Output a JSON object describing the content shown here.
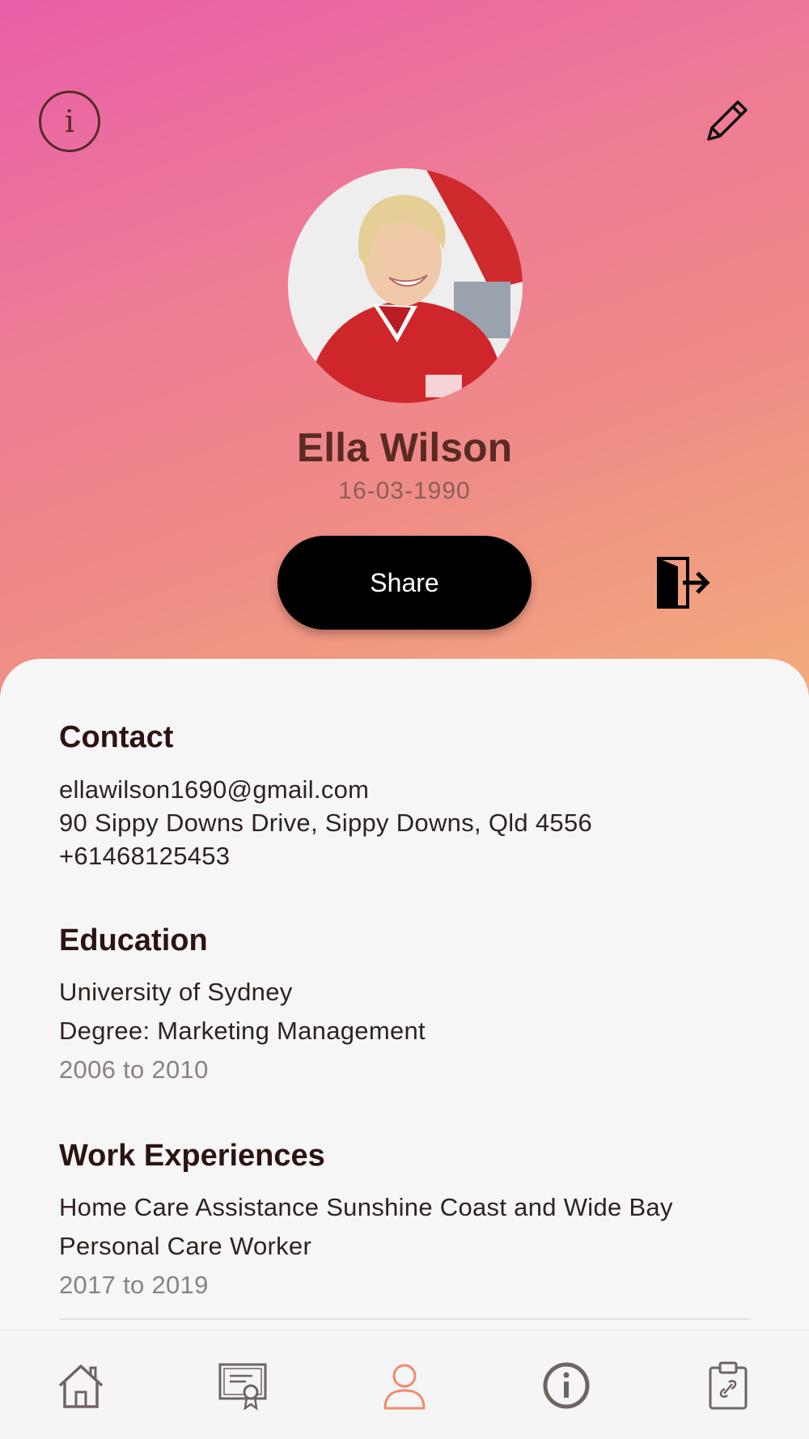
{
  "profile": {
    "name": "Ella Wilson",
    "dob": "16-03-1990",
    "share_label": "Share"
  },
  "icons": {
    "info": "i"
  },
  "contact": {
    "title": "Contact",
    "email": "ellawilson1690@gmail.com",
    "address": "90 Sippy Downs Drive, Sippy Downs, Qld 4556",
    "phone": "+61468125453"
  },
  "education": {
    "title": "Education",
    "school": "University of Sydney",
    "degree": "Degree: Marketing Management",
    "years": "2006 to 2010"
  },
  "work": {
    "title": "Work Experiences",
    "company": "Home Care Assistance Sunshine Coast and Wide Bay",
    "role": "Personal Care Worker",
    "years": "2017 to 2019"
  },
  "tabbar": {
    "items": [
      "home-icon",
      "certificate-icon",
      "profile-icon",
      "info-icon",
      "clipboard-link-icon"
    ],
    "active": "profile-icon",
    "active_color": "#f08a6f",
    "inactive_color": "#6e6462"
  },
  "colors": {
    "gradient_start": "#e95fa9",
    "gradient_end": "#f2ac7c",
    "name_color": "#5a2a24"
  }
}
